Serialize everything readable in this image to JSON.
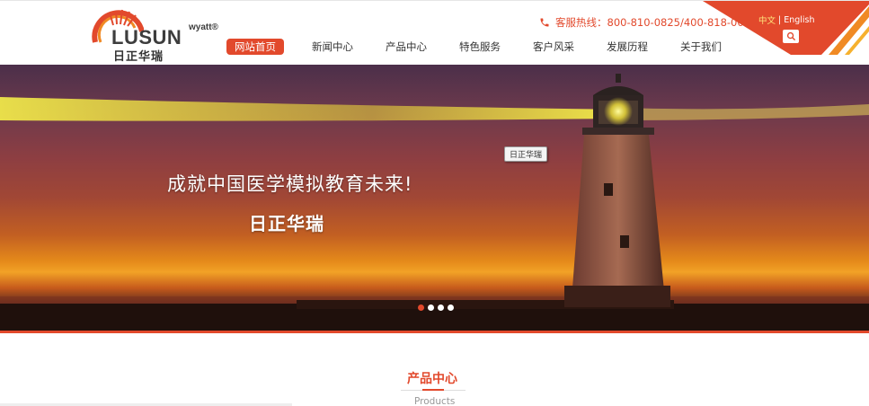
{
  "brand": {
    "logo_text": "LUSUN",
    "logo_sub": "wyatt®",
    "logo_cn": "日正华瑞",
    "accent_color": "#e2492c"
  },
  "header": {
    "hotline": "客服热线：800-810-0825/400-818-0090",
    "lang_cn": "中文",
    "lang_sep": "|",
    "lang_en": "English"
  },
  "nav": {
    "items": [
      {
        "label": "网站首页"
      },
      {
        "label": "新闻中心"
      },
      {
        "label": "产品中心"
      },
      {
        "label": "特色服务"
      },
      {
        "label": "客户风采"
      },
      {
        "label": "发展历程"
      },
      {
        "label": "关于我们"
      }
    ]
  },
  "banner": {
    "slogan_main": "成就中国医学模拟教育未来!",
    "slogan_brand": "日正华瑞",
    "tooltip": "日正华瑞",
    "slide_count": 4,
    "active_slide": 1
  },
  "products": {
    "title": "产品中心",
    "subtitle": "Products"
  },
  "icons": [
    "phone-icon",
    "search-icon",
    "sun-logo-icon"
  ]
}
